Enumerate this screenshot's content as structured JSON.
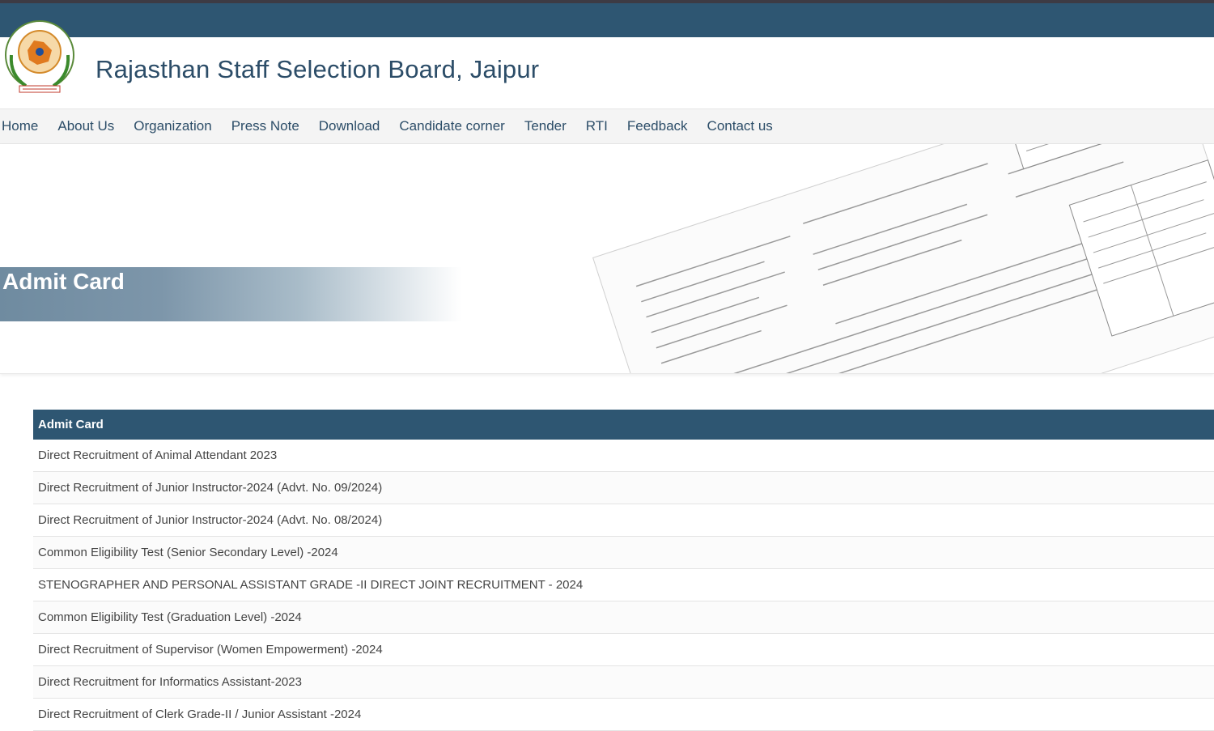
{
  "site": {
    "title": "Rajasthan Staff Selection Board, Jaipur"
  },
  "nav": {
    "items": [
      "Home",
      "About Us",
      "Organization",
      "Press Note",
      "Download",
      "Candidate corner",
      "Tender",
      "RTI",
      "Feedback",
      "Contact us"
    ]
  },
  "hero": {
    "title": "Admit Card"
  },
  "table": {
    "header": "Admit Card",
    "rows": [
      "Direct Recruitment of Animal Attendant 2023",
      "Direct Recruitment of Junior Instructor-2024 (Advt. No. 09/2024)",
      "Direct Recruitment of Junior Instructor-2024 (Advt. No. 08/2024)",
      "Common Eligibility Test (Senior Secondary Level) -2024",
      "STENOGRAPHER AND PERSONAL ASSISTANT GRADE -II DIRECT JOINT RECRUITMENT - 2024",
      "Common Eligibility Test (Graduation Level) -2024",
      "Direct Recruitment of Supervisor (Women Empowerment) -2024",
      "Direct Recruitment for Informatics Assistant-2023",
      "Direct Recruitment of Clerk Grade-II / Junior Assistant -2024"
    ]
  },
  "colors": {
    "primary": "#2e5672",
    "title_text": "#2c4d68",
    "nav_bg": "#f4f4f4"
  },
  "icons": {
    "logo": "rsmssb-emblem-logo"
  }
}
